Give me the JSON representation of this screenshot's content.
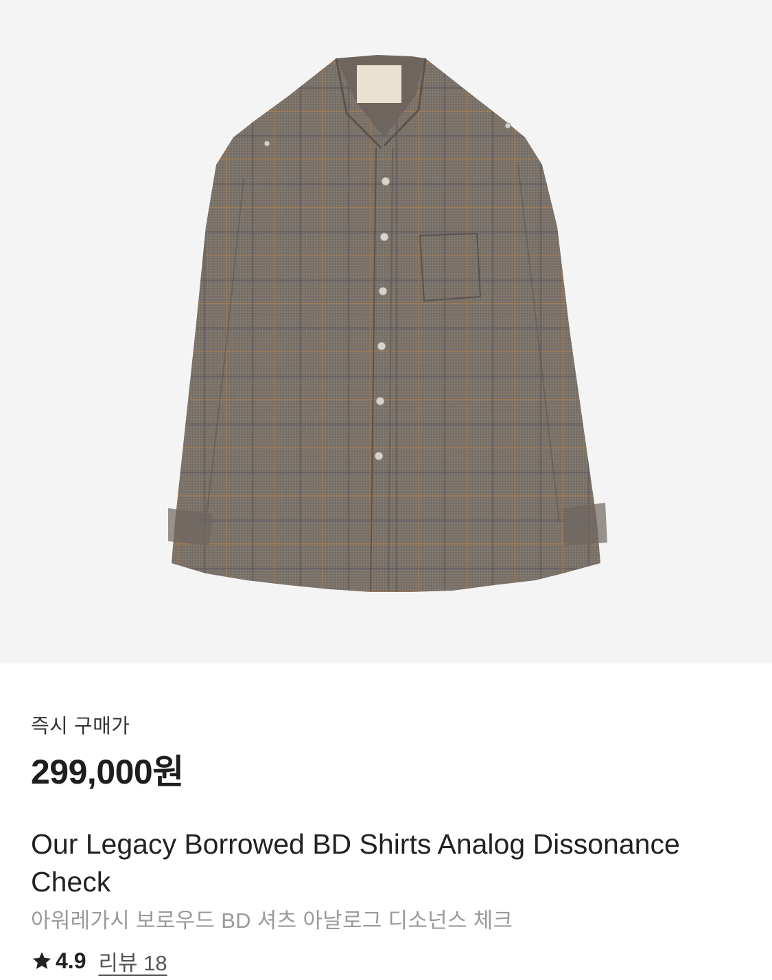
{
  "product": {
    "image_alt": "Our Legacy Borrowed BD Shirts Analog Dissonance Check",
    "price_label": "즉시 구매가",
    "price": "299,000원",
    "name_en": "Our Legacy Borrowed BD Shirts Analog Dissonance Check",
    "name_ko": "아워레가시 보로우드 BD 셔츠 아날로그 디소넌스 체크",
    "rating": "4.9",
    "review_link": "리뷰 18"
  },
  "colors": {
    "image_background": "#f4f4f4",
    "shirt": "#7a716a",
    "price_text": "#1e1e1e",
    "subtitle_text": "#9a9a9a"
  },
  "icons": {
    "rating": "star-icon"
  }
}
